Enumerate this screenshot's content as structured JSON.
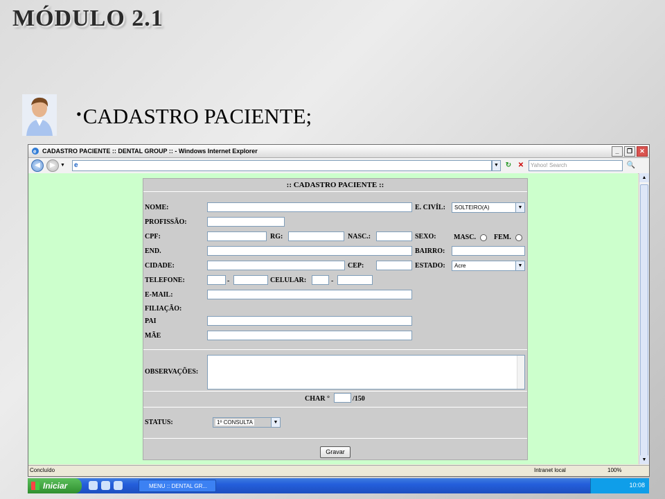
{
  "slide": {
    "title": "MÓDULO 2.1",
    "bullet": "CADASTRO PACIENTE;"
  },
  "browser": {
    "window_title": "CADASTRO PACIENTE :: DENTAL GROUP :: - Windows Internet Explorer",
    "address": "",
    "search_placeholder": "Yahoo! Search",
    "status_left": "Concluído",
    "status_zone": "Intranet local",
    "zoom": "100%"
  },
  "form": {
    "header": ":: CADASTRO PACIENTE ::",
    "labels": {
      "nome": "NOME:",
      "estado_civil": "E. CIVÍL:",
      "profissao": "PROFISSÃO:",
      "cpf": "CPF:",
      "rg": "RG:",
      "nasc": "NASC.:",
      "sexo": "SEXO:",
      "masc": "MASC.",
      "fem": "FEM.",
      "endereco": "END.",
      "bairro": "BAIRRO:",
      "cidade": "CIDADE:",
      "cep": "CEP:",
      "estado": "ESTADO:",
      "telefone": "TELEFONE:",
      "celular": "CELULAR:",
      "email": "E-MAIL:",
      "filiacao": "FILIAÇÃO:",
      "pai": "PAI",
      "mae": "MÃE",
      "observacoes": "OBSERVAÇÕES:",
      "char": "CHAR °",
      "char_max": "/150",
      "status": "STATUS:",
      "dash": "-"
    },
    "estado_civil_value": "SOLTEIRO(A)",
    "estado_value": "Acre",
    "status_value": "1º CONSULTA",
    "submit": "Gravar"
  },
  "taskbar": {
    "start": "Iniciar",
    "task": "MENU :: DENTAL GR...",
    "clock": "10:08"
  },
  "colors": {
    "page_bg": "#ccffcc",
    "panel_bg": "#cccccc",
    "taskbar": "#245edb"
  }
}
